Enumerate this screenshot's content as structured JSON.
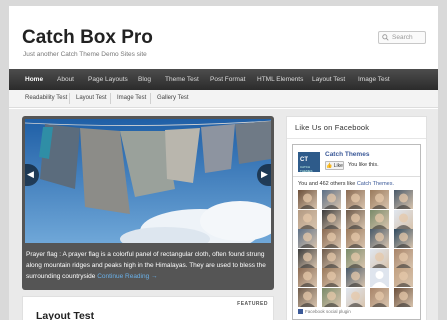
{
  "site": {
    "title": "Catch Box Pro",
    "description": "Just another Catch Theme Demo Sites site"
  },
  "search": {
    "placeholder": "Search"
  },
  "primary_nav": [
    "Home",
    "About",
    "Page Layouts",
    "Blog",
    "Theme Test",
    "Post Format",
    "HTML Elements",
    "Layout Test",
    "Image Test"
  ],
  "secondary_nav": [
    "Readability Test",
    "Layout Test",
    "Image Test",
    "Gallery Test"
  ],
  "slider": {
    "caption": "Prayer flag : A prayer flag is a colorful panel of rectangular cloth, often found strung along mountain ridges and peaks high in the Himalayas. They are used to bless the surrounding countryside",
    "read_more": "Continue Reading →"
  },
  "post": {
    "badge": "FEATURED",
    "title": "Layout Test"
  },
  "widget": {
    "title": "Like Us on Facebook",
    "page_name": "Catch Themes",
    "logo_text": "CT",
    "logo_sub": "CATCH THEMES",
    "like_button": "👍 Like",
    "like_text": "You like this.",
    "count_prefix": "You and 462 others like ",
    "count_link": "Catch Themes.",
    "plugin_label": "Facebook social plugin"
  },
  "colors": {
    "nav_bg": "#3a3a3a",
    "link": "#3b5998",
    "read_more": "#6ab0e8"
  }
}
